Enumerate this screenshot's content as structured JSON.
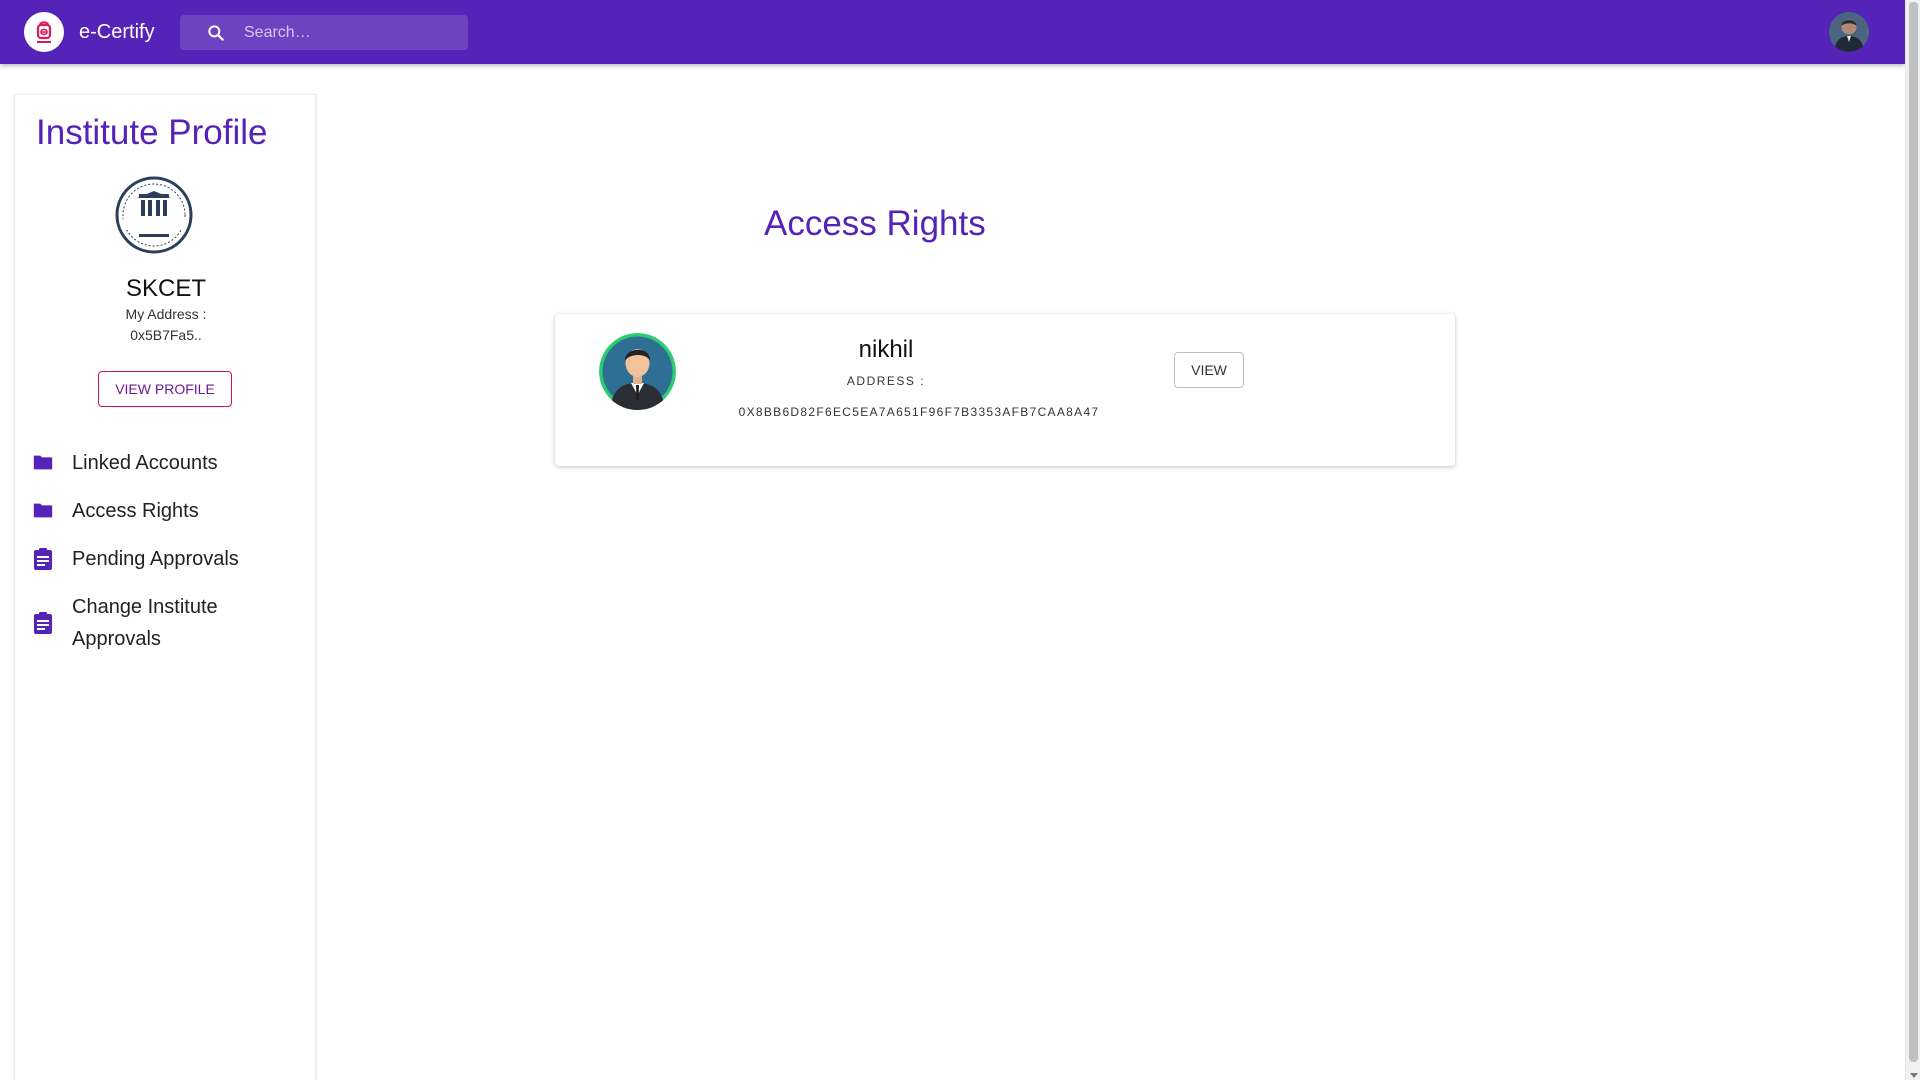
{
  "header": {
    "brand": "e-Certify",
    "logo_icon": "e-certify-logo-icon",
    "search_placeholder": "Search…",
    "search_icon": "search-icon",
    "user_avatar_icon": "user-avatar",
    "bar_color": "#5523b8"
  },
  "sidebar": {
    "title": "Institute Profile",
    "institute_logo": "institute-seal-logo",
    "institute_name": "SKCET",
    "address_label": "My Address :",
    "address_value": "0x5B7Fa5..",
    "view_profile_label": "VIEW PROFILE",
    "items": [
      {
        "label": "Linked Accounts",
        "icon": "folder-icon"
      },
      {
        "label": "Access Rights",
        "icon": "folder-icon"
      },
      {
        "label": "Pending Approvals",
        "icon": "assignment-icon"
      },
      {
        "label": "Change Institute Approvals",
        "icon": "assignment-icon"
      }
    ]
  },
  "main": {
    "title": "Access Rights",
    "cards": [
      {
        "name": "nikhil",
        "address_label": "ADDRESS :",
        "address": "0X8BB6D82F6EC5EA7A651F96F7B3353AFB7CAA8A47",
        "view_label": "VIEW",
        "avatar_icon": "user-avatar-icon"
      }
    ]
  },
  "colors": {
    "accent": "#5523b8",
    "view_profile_border": "#c2185b",
    "card_avatar_ring": "#2ecc71"
  }
}
